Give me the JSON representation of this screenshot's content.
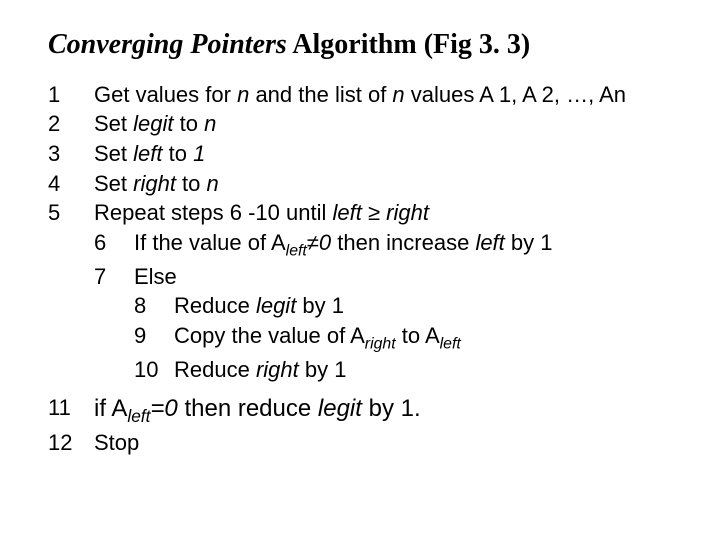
{
  "title": {
    "prefix": "Converging Pointers",
    "rest": " Algorithm (Fig 3. 3)"
  },
  "steps": {
    "s1": {
      "num": "1",
      "a": "Get values for ",
      "n1": "n",
      "b": " and the list of ",
      "n2": "n",
      "c": " values A 1, A 2, …, An"
    },
    "s2": {
      "num": "2",
      "a": "Set ",
      "legit": "legit",
      "b": " to ",
      "n": "n"
    },
    "s3": {
      "num": "3",
      "a": "Set ",
      "left": "left",
      "b": " to ",
      "v": "1"
    },
    "s4": {
      "num": "4",
      "a": "Set ",
      "right": "right",
      "b": " to ",
      "n": "n"
    },
    "s5": {
      "num": "5",
      "a": "Repeat steps 6 -10 until ",
      "left": "left",
      "ge": " ≥ ",
      "right": "right"
    },
    "s6": {
      "num": "6",
      "a": "If the value of A",
      "sub": "left",
      "b": "≠",
      "zero": "0",
      "c": " then increase ",
      "left": "left",
      "d": " by 1"
    },
    "s7": {
      "num": "7",
      "a": "Else"
    },
    "s8": {
      "num": "8",
      "a": "Reduce ",
      "legit": "legit",
      "b": " by 1"
    },
    "s9": {
      "num": "9",
      "a": "Copy the value of A",
      "sub1": "right",
      "b": " to A",
      "sub2": "left"
    },
    "s10": {
      "num": "10",
      "a": "Reduce ",
      "right": "right",
      "b": " by 1"
    },
    "s11": {
      "num": "11",
      "a": "if A",
      "sub": "left",
      "b": "=",
      "zero": "0",
      "c": " then reduce ",
      "legit": "legit",
      "d": " by 1."
    },
    "s12": {
      "num": "12",
      "a": "Stop"
    }
  }
}
